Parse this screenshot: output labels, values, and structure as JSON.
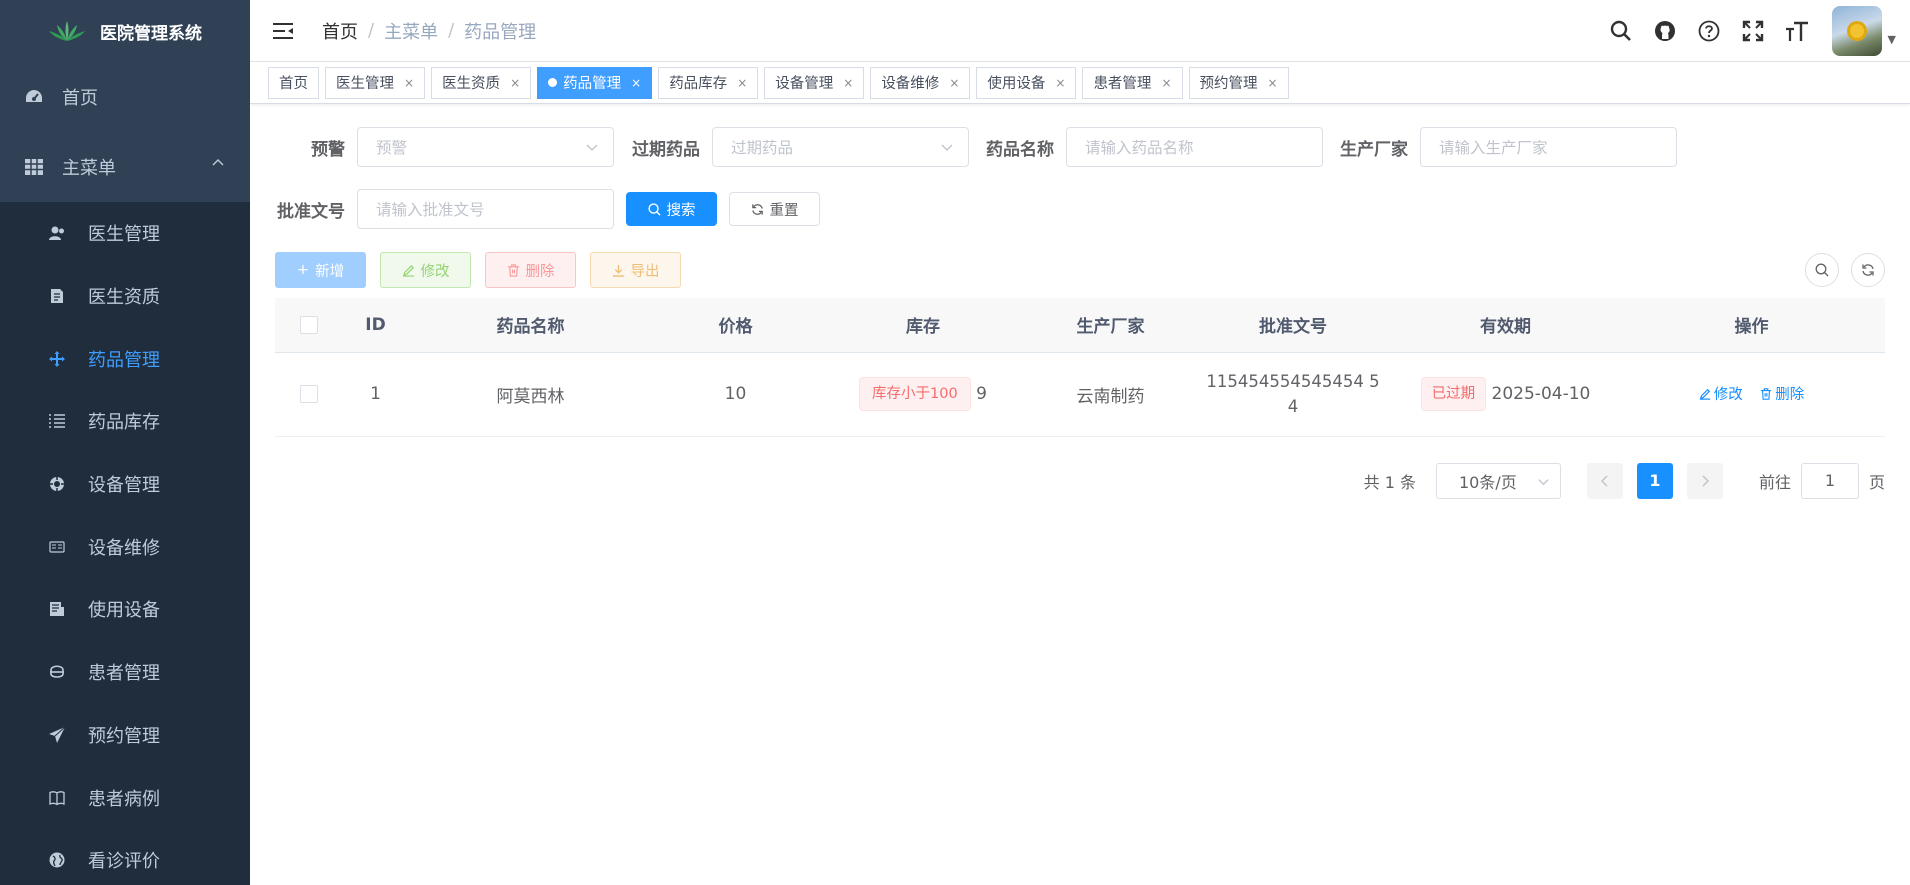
{
  "app": {
    "title": "医院管理系统"
  },
  "sidebar": {
    "home": "首页",
    "main_menu": "主菜单",
    "items": [
      {
        "label": "医生管理",
        "icon": "doctor-icon"
      },
      {
        "label": "医生资质",
        "icon": "certificate-icon"
      },
      {
        "label": "药品管理",
        "icon": "drug-icon",
        "active": true
      },
      {
        "label": "药品库存",
        "icon": "list-icon"
      },
      {
        "label": "设备管理",
        "icon": "device-icon"
      },
      {
        "label": "设备维修",
        "icon": "repair-icon"
      },
      {
        "label": "使用设备",
        "icon": "usage-icon"
      },
      {
        "label": "患者管理",
        "icon": "patient-icon"
      },
      {
        "label": "预约管理",
        "icon": "send-icon"
      },
      {
        "label": "患者病例",
        "icon": "book-icon"
      },
      {
        "label": "看诊评价",
        "icon": "globe-icon"
      }
    ]
  },
  "breadcrumb": [
    "首页",
    "主菜单",
    "药品管理"
  ],
  "tags": [
    {
      "label": "首页",
      "closable": false
    },
    {
      "label": "医生管理",
      "closable": true
    },
    {
      "label": "医生资质",
      "closable": true
    },
    {
      "label": "药品管理",
      "closable": true,
      "active": true
    },
    {
      "label": "药品库存",
      "closable": true
    },
    {
      "label": "设备管理",
      "closable": true
    },
    {
      "label": "设备维修",
      "closable": true
    },
    {
      "label": "使用设备",
      "closable": true
    },
    {
      "label": "患者管理",
      "closable": true
    },
    {
      "label": "预约管理",
      "closable": true
    }
  ],
  "search": {
    "warning_label": "预警",
    "warning_placeholder": "预警",
    "expired_label": "过期药品",
    "expired_placeholder": "过期药品",
    "name_label": "药品名称",
    "name_placeholder": "请输入药品名称",
    "maker_label": "生产厂家",
    "maker_placeholder": "请输入生产厂家",
    "approval_label": "批准文号",
    "approval_placeholder": "请输入批准文号",
    "search_btn": "搜索",
    "reset_btn": "重置"
  },
  "toolbar": {
    "add": "新增",
    "edit": "修改",
    "delete": "删除",
    "export": "导出"
  },
  "table": {
    "columns": [
      "ID",
      "药品名称",
      "价格",
      "库存",
      "生产厂家",
      "批准文号",
      "有效期",
      "操作"
    ],
    "rows": [
      {
        "id": "1",
        "name": "阿莫西林",
        "price": "10",
        "stock_tag": "库存小于100",
        "stock": "9",
        "maker": "云南制药",
        "approval_line1": "115454554545454 5",
        "approval_line2": "4",
        "expired_tag": "已过期",
        "expiry": "2025-04-10",
        "edit": "修改",
        "delete": "删除"
      }
    ]
  },
  "pagination": {
    "total": "共 1 条",
    "page_size": "10条/页",
    "current": "1",
    "goto_prefix": "前往",
    "goto_value": "1",
    "goto_suffix": "页"
  },
  "colors": {
    "sidebar_bg": "#304156",
    "submenu_bg": "#1f2d3d",
    "primary": "#1890ff",
    "active_text": "#409eff",
    "danger": "#f56c6c"
  }
}
